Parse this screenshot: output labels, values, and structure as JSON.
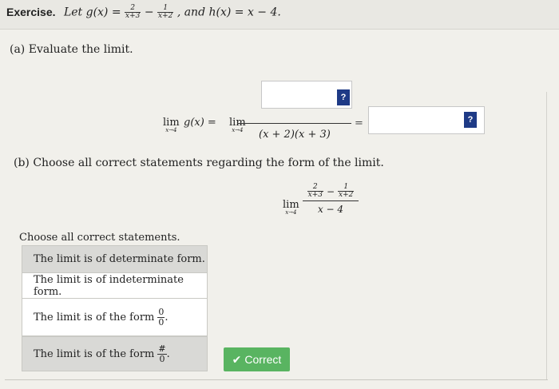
{
  "header": {
    "label": "Exercise.",
    "prefix": "Let g(x) =",
    "f1_num": "2",
    "f1_den": "x+3",
    "minus": "−",
    "f2_num": "1",
    "f2_den": "x+2",
    "suffix": ", and h(x) = x − 4."
  },
  "part_a": {
    "title": "(a) Evaluate the limit.",
    "lim_word": "lim",
    "lim_sub": "x→4",
    "g_label": "g(x) =",
    "denominator": "(x + 2)(x + 3)",
    "equals": "=",
    "numerator_value": "",
    "result_value": "",
    "help_label": "?"
  },
  "part_b": {
    "title": "(b) Choose all correct statements regarding the form of the limit.",
    "lim_word": "lim",
    "lim_sub": "x→4",
    "f1_num": "2",
    "f1_den": "x+3",
    "minus": "−",
    "f2_num": "1",
    "f2_den": "x+2",
    "den": "x − 4"
  },
  "choices": {
    "label": "Choose all correct statements.",
    "options": [
      {
        "text": "The limit is of determinate form.",
        "selected": true
      },
      {
        "text": "The limit is of indeterminate form.",
        "selected": false
      },
      {
        "text": "The limit is of the form",
        "frac_num": "0",
        "frac_den": "0",
        "selected": false
      },
      {
        "text": "The limit is of the form",
        "frac_num": "#",
        "frac_den": "0",
        "selected": true
      }
    ]
  },
  "status": {
    "correct_label": "Correct",
    "check_icon": "✔"
  },
  "colors": {
    "help_button": "#1e3a86",
    "correct_badge": "#59b461",
    "selected_option": "#d9d9d6"
  }
}
